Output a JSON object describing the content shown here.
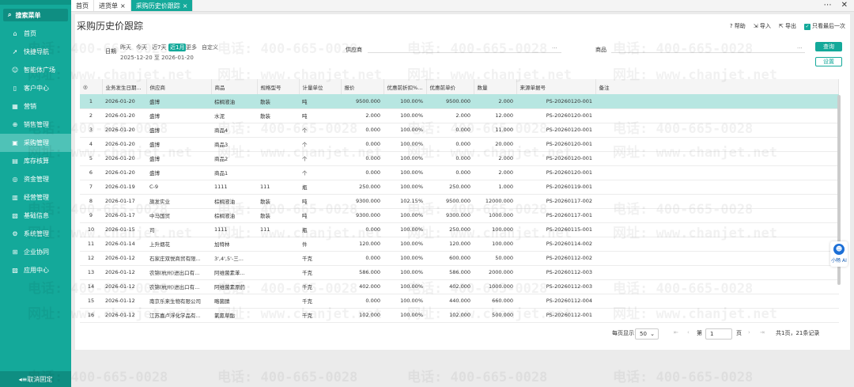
{
  "sidebar": {
    "search_label": "搜索菜单",
    "items": [
      {
        "label": "首页",
        "icon": "home-icon",
        "glyph": "⌂"
      },
      {
        "label": "快捷导航",
        "icon": "rocket-icon",
        "glyph": "➚"
      },
      {
        "label": "智能体广场",
        "icon": "robot-icon",
        "glyph": "☺"
      },
      {
        "label": "客户中心",
        "icon": "book-icon",
        "glyph": "▯"
      },
      {
        "label": "营销",
        "icon": "chart-icon",
        "glyph": "▦"
      },
      {
        "label": "销售管理",
        "icon": "cart-icon",
        "glyph": "⊕"
      },
      {
        "label": "采购管理",
        "icon": "purchase-icon",
        "glyph": "▣",
        "active": true
      },
      {
        "label": "库存核算",
        "icon": "warehouse-icon",
        "glyph": "▤"
      },
      {
        "label": "资金管理",
        "icon": "money-icon",
        "glyph": "◎"
      },
      {
        "label": "经营管理",
        "icon": "business-icon",
        "glyph": "▥"
      },
      {
        "label": "基础信息",
        "icon": "info-icon",
        "glyph": "▧"
      },
      {
        "label": "系统管理",
        "icon": "settings-icon",
        "glyph": "⚙"
      },
      {
        "label": "企业协同",
        "icon": "collab-icon",
        "glyph": "⊞"
      },
      {
        "label": "应用中心",
        "icon": "apps-icon",
        "glyph": "▨"
      }
    ],
    "collapse_label": "◂≡取消固定"
  },
  "tabs": [
    {
      "label": "首页",
      "closable": false
    },
    {
      "label": "进货单",
      "closable": true
    },
    {
      "label": "采购历史价跟踪",
      "closable": true,
      "active": true
    }
  ],
  "window": {
    "more": "⋯",
    "close": "✕"
  },
  "page": {
    "title": "采购历史价跟踪",
    "toolbar": {
      "help": "帮助",
      "import": "导入",
      "export": "导出",
      "only_last": "只看最后一次"
    },
    "filter": {
      "date_label": "日期",
      "date_chips": [
        "昨天",
        "今天",
        "近7天",
        "近1月",
        "更多",
        "自定义"
      ],
      "selected_chip": "近1月",
      "date_range": "2025-12-20 至 2026-01-20",
      "supplier_label": "供应商",
      "goods_label": "商品",
      "ellipsis": "···",
      "query_button": "查询",
      "settings_button": "设置"
    }
  },
  "table": {
    "headers": [
      "◎",
      "业务发生日期...",
      "供应商",
      "商品",
      "规格型号",
      "计量单位",
      "报价",
      "优惠前折扣%...",
      "优惠前单价",
      "数量",
      "来源单据号",
      "备注"
    ],
    "rows": [
      [
        "1",
        "2026-01-20",
        "盛博",
        "棕榈液油",
        "散装",
        "吨",
        "9500.000",
        "100.00%",
        "9500.000",
        "2.000",
        "PS-20260120-001",
        ""
      ],
      [
        "2",
        "2026-01-20",
        "盛博",
        "水泥",
        "散装",
        "吨",
        "2.000",
        "100.00%",
        "2.000",
        "12.000",
        "PS-20260120-001",
        ""
      ],
      [
        "3",
        "2026-01-20",
        "盛博",
        "商品4",
        "",
        "个",
        "0.000",
        "100.00%",
        "0.000",
        "11.000",
        "PS-20260120-001",
        ""
      ],
      [
        "4",
        "2026-01-20",
        "盛博",
        "商品3",
        "",
        "个",
        "0.000",
        "100.00%",
        "0.000",
        "20.000",
        "PS-20260120-001",
        ""
      ],
      [
        "5",
        "2026-01-20",
        "盛博",
        "商品2",
        "",
        "个",
        "0.000",
        "100.00%",
        "0.000",
        "2.000",
        "PS-20260120-001",
        ""
      ],
      [
        "6",
        "2026-01-20",
        "盛博",
        "商品1",
        "",
        "个",
        "0.000",
        "100.00%",
        "0.000",
        "2.000",
        "PS-20260120-001",
        ""
      ],
      [
        "7",
        "2026-01-19",
        "C-9",
        "1111",
        "111",
        "瓶",
        "250.000",
        "100.00%",
        "250.000",
        "1.000",
        "PS-20260119-001",
        ""
      ],
      [
        "8",
        "2026-01-17",
        "旗发实业",
        "棕榈液油",
        "散装",
        "吨",
        "9300.000",
        "102.15%",
        "9500.000",
        "12000.000",
        "PS-20260117-002",
        ""
      ],
      [
        "9",
        "2026-01-17",
        "中马国贸",
        "棕榈液油",
        "散装",
        "吨",
        "9300.000",
        "100.00%",
        "9300.000",
        "1000.000",
        "PS-20260117-001",
        ""
      ],
      [
        "10",
        "2026-01-15",
        "司",
        "1111",
        "111",
        "瓶",
        "0.000",
        "100.00%",
        "250.000",
        "100.000",
        "PS-20260115-001",
        ""
      ],
      [
        "11",
        "2026-01-14",
        "上升烟花",
        "加特林",
        "",
        "件",
        "120.000",
        "100.00%",
        "120.000",
        "100.000",
        "PS-20260114-002",
        ""
      ],
      [
        "12",
        "2026-01-12",
        "石家庄双悦商贸有限...",
        "3',4',5'-三...",
        "",
        "千克",
        "0.000",
        "100.00%",
        "600.000",
        "50.000",
        "PS-20260112-002",
        ""
      ],
      [
        "13",
        "2026-01-12",
        "农锦(杭州)进出口有...",
        "阿维菌素苯...",
        "",
        "千克",
        "586.000",
        "100.00%",
        "586.000",
        "2000.000",
        "PS-20260112-003",
        ""
      ],
      [
        "14",
        "2026-01-12",
        "农锦(杭州)进出口有...",
        "阿维菌素原药",
        "",
        "千克",
        "402.000",
        "100.00%",
        "402.000",
        "1000.000",
        "PS-20260112-003",
        ""
      ],
      [
        "15",
        "2026-01-12",
        "南京乐来生物有限公司",
        "略菌腈",
        "",
        "千克",
        "0.000",
        "100.00%",
        "440.000",
        "660.000",
        "PS-20260112-004",
        ""
      ],
      [
        "16",
        "2026-01-12",
        "江苏嘉卢浮化学品有...",
        "氯氰草酯",
        "",
        "千克",
        "102.000",
        "100.00%",
        "102.000",
        "500.000",
        "PS-20260112-001",
        ""
      ]
    ]
  },
  "pager": {
    "per_page_label": "每页显示",
    "per_page": "50",
    "page_prefix": "第",
    "page": "1",
    "page_suffix": "页",
    "summary": "共1页，21条记录",
    "first": "⇤",
    "prev": "‹",
    "next": "›",
    "last": "⇥"
  },
  "assistant": {
    "label": "小畅 AI"
  },
  "watermark": {
    "phone": "电话: 400-665-0028",
    "site": "网址: www.chanjet.net"
  },
  "colors": {
    "accent": "#14a99a",
    "highlight_row": "#b7e6e1"
  }
}
